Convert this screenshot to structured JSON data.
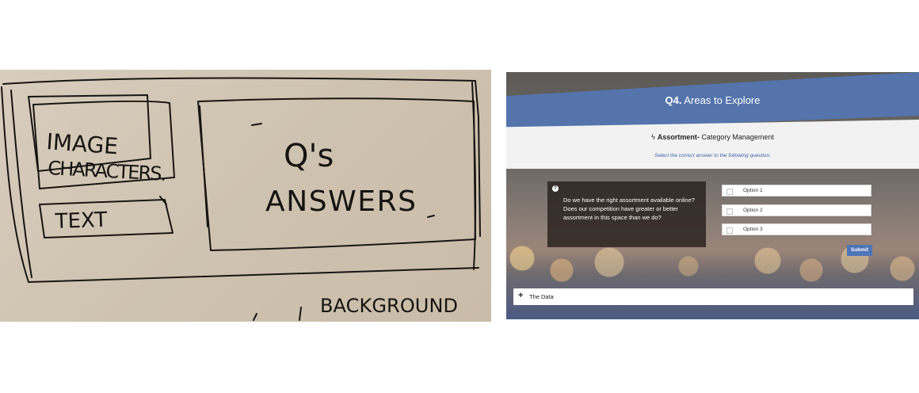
{
  "sketch": {
    "labels": {
      "image_line1": "IMAGE",
      "image_line2": "CHARACTERS.",
      "text_box": "TEXT",
      "qa_line1": "Q's",
      "qa_line2": "ANSWERS",
      "background": "BACKGROUND"
    }
  },
  "mockup": {
    "title_prefix": "Q4.",
    "title_text": " Areas to Explore",
    "category": {
      "icon": "lightning-bolt-icon",
      "bold": "Assortment-",
      "rest": " Category Management"
    },
    "instruction": "Select the correct answer to the following question.",
    "question": {
      "icon": "question-icon",
      "text": "Do we have the right assortment available online?  Does our competition have greater or better assortment in this space than we do?"
    },
    "options": [
      {
        "label": "Option 1"
      },
      {
        "label": "Option 2"
      },
      {
        "label": "Option 3"
      }
    ],
    "submit_label": "Submit",
    "data_section": {
      "icon": "plus-icon",
      "label": "The Data"
    },
    "colors": {
      "accent_blue": "#5474ab",
      "submit_blue": "#4f74b8",
      "instruction_blue": "#3c64a8"
    }
  }
}
